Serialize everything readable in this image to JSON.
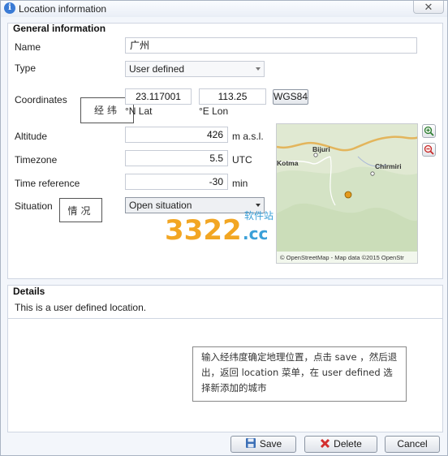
{
  "window": {
    "title": "Location information",
    "close_symbol": "✕"
  },
  "general": {
    "section_title": "General information",
    "name_label": "Name",
    "name_value": "广州",
    "type_label": "Type",
    "type_value": "User defined",
    "coords_label": "Coordinates",
    "lat_value": "23.117001",
    "lon_value": "113.25",
    "lat_unit": "°N Lat",
    "lon_unit": "°E Lon",
    "datum_button": "WGS84",
    "altitude_label": "Altitude",
    "altitude_value": "426",
    "altitude_unit": "m a.s.l.",
    "timezone_label": "Timezone",
    "timezone_value": "5.5",
    "timezone_unit": "UTC",
    "timeref_label": "Time reference",
    "timeref_value": "-30",
    "timeref_unit": "min",
    "situation_label": "Situation",
    "situation_value": "Open situation"
  },
  "annotations": {
    "coords_cn": "经纬",
    "situation_cn": "情况"
  },
  "map": {
    "places": [
      "Bijuri",
      "Chirmiri",
      "Kotma"
    ],
    "attribution": "© OpenStreetMap - Map data ©2015 OpenStr"
  },
  "details": {
    "section_title": "Details",
    "text": "This is a user defined location."
  },
  "watermark": {
    "number": "3322",
    "suffix": ".cc",
    "cn": "软件站"
  },
  "note": {
    "text": "输入经纬度确定地理位置，点击 save ，然后退出，返回 location 菜单，在 user defined 选择新添加的城市"
  },
  "footer": {
    "save": "Save",
    "delete": "Delete",
    "cancel": "Cancel"
  }
}
